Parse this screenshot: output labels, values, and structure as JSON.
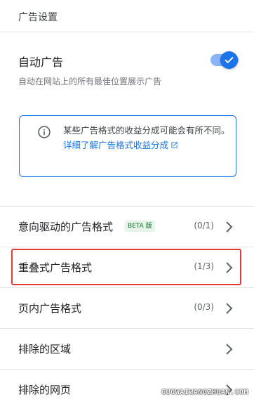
{
  "header": {
    "title": "广告设置"
  },
  "auto_ads": {
    "title": "自动广告",
    "description": "自动在网站上的所有最佳位置展示广告",
    "toggle_on": true,
    "toggle_icon": "check-icon"
  },
  "info_box": {
    "icon": "info-icon",
    "text": "某些广告格式的收益分成可能会有所不同。",
    "link_text": "详细了解广告格式收益分成",
    "link_icon": "external-link-icon"
  },
  "rows": [
    {
      "label": "意向驱动的广告格式",
      "badge": "BETA 版",
      "count": "(0/1)"
    },
    {
      "label": "重叠式广告格式",
      "badge": "",
      "count": "(1/3)"
    },
    {
      "label": "页内广告格式",
      "badge": "",
      "count": "(0/3)"
    },
    {
      "label": "排除的区域",
      "badge": "",
      "count": ""
    },
    {
      "label": "排除的网页",
      "badge": "",
      "count": ""
    }
  ],
  "watermark": "GUOWAIWANGZHUAN.COM",
  "colors": {
    "accent": "#1a73e8",
    "highlight": "#e53935",
    "badge_bg": "#e6f4ea",
    "badge_text": "#137333"
  }
}
